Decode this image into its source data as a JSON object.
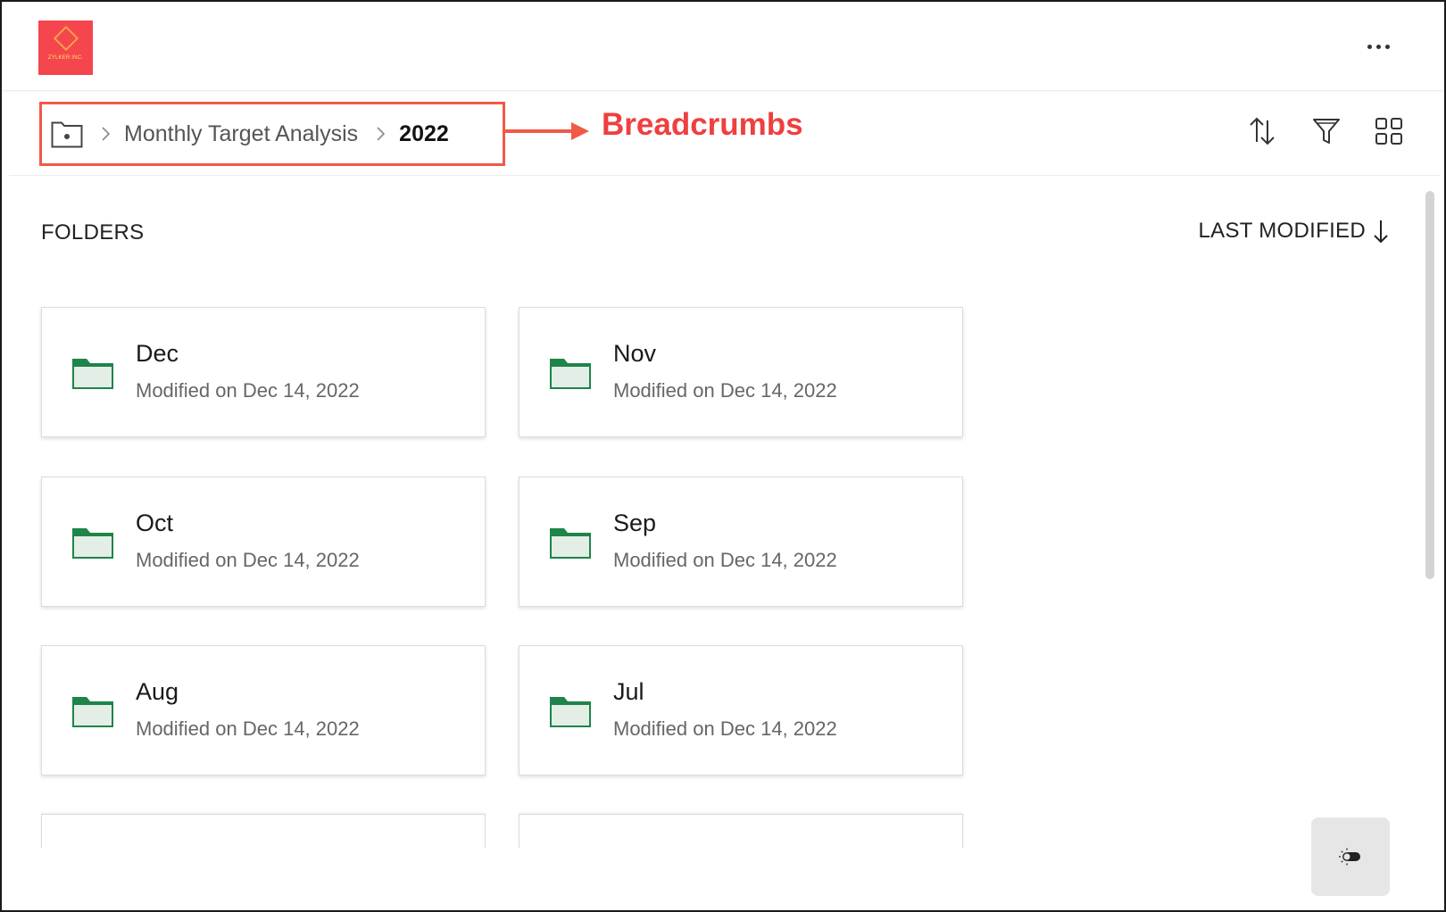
{
  "logo": {
    "text": "ZYLKER INC.",
    "color": "#f5454d"
  },
  "breadcrumb": {
    "items": [
      "Monthly Target Analysis"
    ],
    "current": "2022"
  },
  "annotation": {
    "label": "Breadcrumbs",
    "color": "#ef3f3f"
  },
  "section": {
    "title": "FOLDERS",
    "sort_label": "LAST MODIFIED"
  },
  "folders": [
    {
      "name": "Dec",
      "meta": "Modified on Dec 14, 2022"
    },
    {
      "name": "Nov",
      "meta": "Modified on Dec 14, 2022"
    },
    {
      "name": "Oct",
      "meta": "Modified on Dec 14, 2022"
    },
    {
      "name": "Sep",
      "meta": "Modified on Dec 14, 2022"
    },
    {
      "name": "Aug",
      "meta": "Modified on Dec 14, 2022"
    },
    {
      "name": "Jul",
      "meta": "Modified on Dec 14, 2022"
    }
  ],
  "icons": {
    "more": "more-horizontal-icon",
    "sort": "sort-icon",
    "filter": "filter-icon",
    "grid": "grid-view-icon",
    "theme": "theme-toggle-icon"
  },
  "colors": {
    "folder": "#1e8449",
    "folder_fill": "#e3eee6",
    "accent": "#ef5a46"
  }
}
